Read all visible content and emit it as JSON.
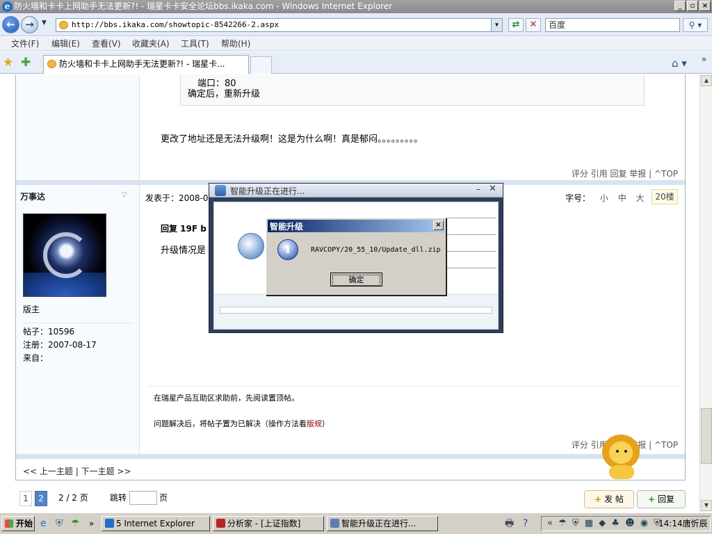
{
  "window": {
    "title": "防火墙和卡卡上网助手无法更新?! - 瑞星卡卡安全论坛bbs.ikaka.com - Windows Internet Explorer"
  },
  "browser": {
    "url": "http://bbs.ikaka.com/showtopic-8542266-2.aspx",
    "search_placeholder": "百度",
    "tab_title": "防火墙和卡卡上网助手无法更新?! - 瑞星卡...",
    "menu": [
      "文件(F)",
      "编辑(E)",
      "查看(V)",
      "收藏夹(A)",
      "工具(T)",
      "帮助(H)"
    ]
  },
  "post1": {
    "quote_port": "端口：80",
    "quote_after": "确定后，重新升级",
    "text": "更改了地址还是无法升级啊！这是为什么啊！真是郁闷。。。。。。。。。",
    "actions": "评分 引用 回复 举报 | ^TOP"
  },
  "post2": {
    "author": "万事达",
    "rank": "版主",
    "posts_label": "帖子：10596",
    "reg_label": "注册：2007-08-17",
    "from_label": "来自：",
    "posted_label": "发表于：2008-0",
    "font_label": "字号：",
    "font_sizes": [
      "小",
      "中",
      "大"
    ],
    "floor": "20楼",
    "reply_head": "回复 19F b",
    "text": "升级情况是",
    "sig1": "在瑞星产品互助区求助前，先阅读置顶帖。",
    "sig2_pre": "问题解决后，将帖子置为已解决（操作方法看",
    "sig2_link": "版规",
    "sig2_post": "）",
    "actions": "评分 引用 回复 举报 | ^TOP"
  },
  "thread_nav": "<< 上一主题 | 下一主题 >>",
  "pager": {
    "pages": [
      "1",
      "2"
    ],
    "count": "2 / 2 页",
    "jump_label": "跳转",
    "unit": "页"
  },
  "buttons": {
    "post": "发 帖",
    "reply": "回复"
  },
  "update_window": {
    "title": "智能升级正在进行..."
  },
  "msgbox": {
    "title": "智能升级",
    "message": "RAVCOPY/20_55_10/Update_dll.zip",
    "ok": "确定"
  },
  "taskbar": {
    "start": "开始",
    "tasks": [
      "5 Internet Explorer",
      "分析家 - [上证指数]",
      "智能升级正在进行..."
    ],
    "clock": "14:14唐忻辰"
  }
}
